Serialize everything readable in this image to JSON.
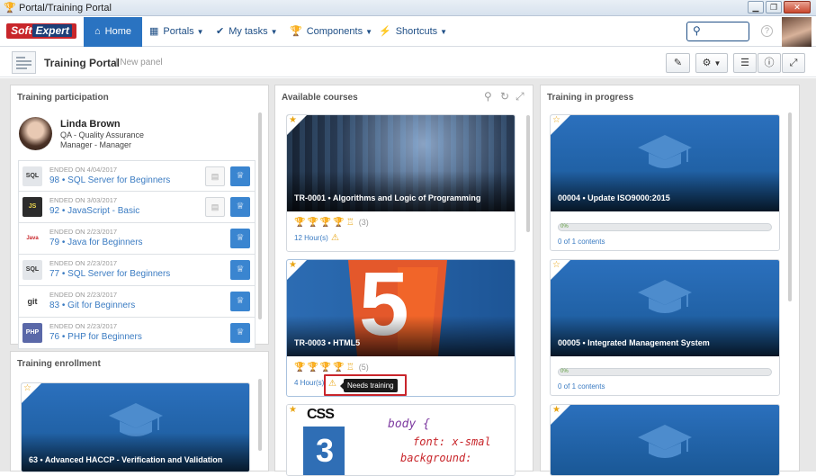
{
  "window": {
    "title": "Portal/Training Portal"
  },
  "nav": {
    "logo_soft": "Soft",
    "logo_expert": "Expert",
    "items": [
      {
        "label": "Home",
        "icon": "home-icon"
      },
      {
        "label": "Portals",
        "icon": "grid-icon"
      },
      {
        "label": "My tasks",
        "icon": "check-icon"
      },
      {
        "label": "Components",
        "icon": "trophy-icon"
      },
      {
        "label": "Shortcuts",
        "icon": "bolt-icon"
      }
    ],
    "help": "?"
  },
  "header": {
    "title": "Training Portal",
    "subtitle": "| New panel"
  },
  "participation": {
    "title": "Training participation",
    "user": {
      "name": "Linda Brown",
      "department": "QA - Quality Assurance",
      "position": "Manager - Manager"
    },
    "items": [
      {
        "date": "ENDED ON 4/04/2017",
        "name": "98 • SQL Server for Beginners",
        "thumb": "SQL",
        "has_doc": true
      },
      {
        "date": "ENDED ON 3/03/2017",
        "name": "92 • JavaScript - Basic",
        "thumb": "JS",
        "has_doc": true
      },
      {
        "date": "ENDED ON 2/23/2017",
        "name": "79 • Java for Beginners",
        "thumb": "Java",
        "has_doc": false
      },
      {
        "date": "ENDED ON 2/23/2017",
        "name": "77 • SQL Server for Beginners",
        "thumb": "SQL",
        "has_doc": false
      },
      {
        "date": "ENDED ON 2/23/2017",
        "name": "83 • Git for Beginners",
        "thumb": "git",
        "has_doc": false
      },
      {
        "date": "ENDED ON 2/23/2017",
        "name": "76 • PHP for Beginners",
        "thumb": "PHP",
        "has_doc": false
      }
    ]
  },
  "enrollment": {
    "title": "Training enrollment",
    "card_title": "63 • Advanced HACCP - Verification and Validation"
  },
  "available": {
    "title": "Available courses",
    "cards": [
      {
        "title": "TR-0001 • Algorithms and Logic of Programming",
        "count": "(3)",
        "hours": "12 Hour(s)"
      },
      {
        "title": "TR-0003 • HTML5",
        "count": "(5)",
        "hours": "4 Hour(s)"
      },
      {
        "title": "",
        "code_line1": "body {",
        "code_line2": "font: x-smal",
        "code_line3": "background:"
      }
    ],
    "tooltip": "Needs training",
    "html5_glyph": "5",
    "css_label": "CSS",
    "css3_glyph": "3"
  },
  "progress": {
    "title": "Training in progress",
    "cards": [
      {
        "title": "00004 • Update ISO9000:2015",
        "percent": "0%",
        "percent_value": 0,
        "contents": "0 of 1 contents"
      },
      {
        "title": "00005 • Integrated Management System",
        "percent": "0%",
        "percent_value": 0,
        "contents": "0 of 1 contents"
      },
      {
        "title": ""
      }
    ]
  },
  "colors": {
    "accent": "#2a73c1",
    "brand_red": "#c8262b",
    "trophy": "#e9a514",
    "card_blue": "#1f63ad"
  }
}
